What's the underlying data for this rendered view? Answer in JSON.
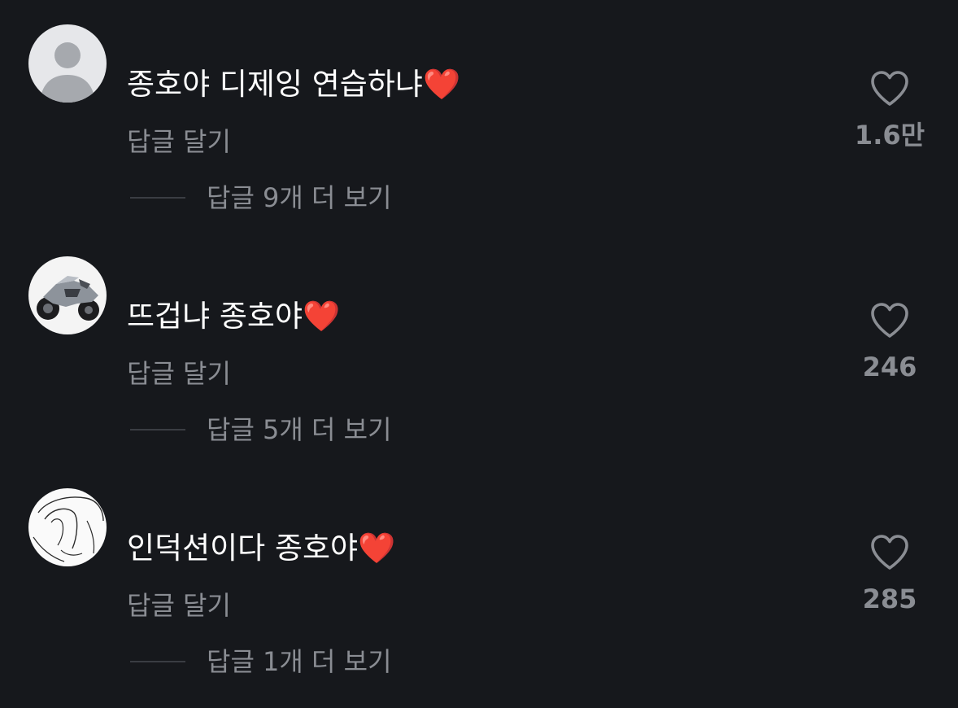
{
  "comments": [
    {
      "avatar": "default-user-avatar",
      "text": "종호야 디제잉 연습하냐",
      "emoji": "❤️",
      "reply_label": "답글 달기",
      "more_replies_label": "답글 9개 더 보기",
      "like_icon": "heart-outline-icon",
      "like_count": "1.6만"
    },
    {
      "avatar": "motorcycle-avatar",
      "text": "뜨겁냐 종호야",
      "emoji": "❤️",
      "reply_label": "답글 달기",
      "more_replies_label": "답글 5개 더 보기",
      "like_icon": "heart-outline-icon",
      "like_count": "246"
    },
    {
      "avatar": "sketch-drawing-avatar",
      "text": "인덕션이다 종호야",
      "emoji": "❤️",
      "reply_label": "답글 달기",
      "more_replies_label": "답글 1개 더 보기",
      "like_icon": "heart-outline-icon",
      "like_count": "285"
    }
  ],
  "colors": {
    "background": "#16181c",
    "text_primary": "#ffffff",
    "text_secondary": "#8a8d93",
    "heart_emoji": "#e8262f"
  }
}
